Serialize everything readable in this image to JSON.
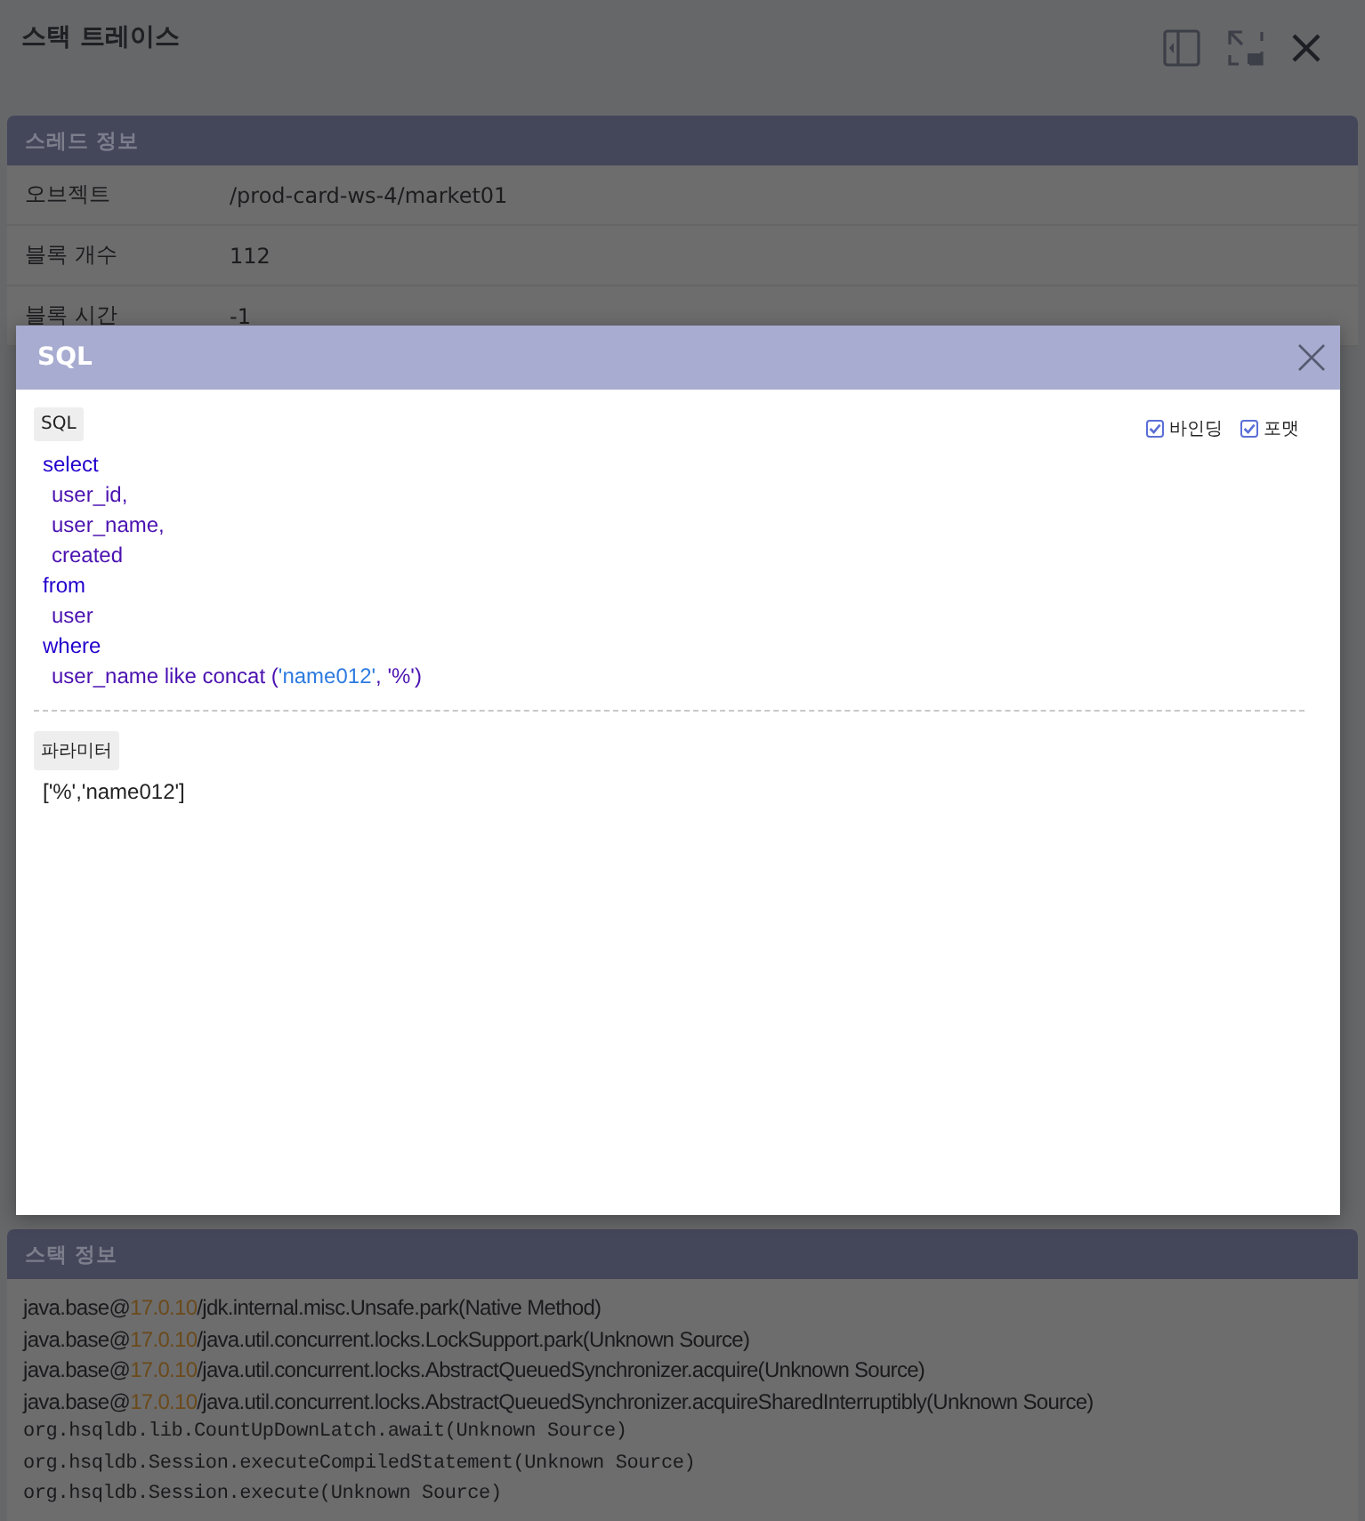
{
  "window": {
    "title": "스택 트레이스"
  },
  "thread_info": {
    "title": "스레드 정보",
    "rows": [
      {
        "label": "오브젝트",
        "value": "/prod-card-ws-4/market01"
      },
      {
        "label": "블록 개수",
        "value": "112"
      },
      {
        "label": "블록 시간",
        "value": "-1"
      }
    ]
  },
  "sql_dialog": {
    "title": "SQL",
    "sql_tag": "SQL",
    "options": [
      {
        "label": "바인딩",
        "checked": true
      },
      {
        "label": "포맷",
        "checked": true
      }
    ],
    "sql_lines": [
      {
        "indent": false,
        "segments": [
          {
            "text": "select",
            "kind": "keyword"
          }
        ]
      },
      {
        "indent": true,
        "segments": [
          {
            "text": "user_id,",
            "kind": "ident"
          }
        ]
      },
      {
        "indent": true,
        "segments": [
          {
            "text": "user_name,",
            "kind": "ident"
          }
        ]
      },
      {
        "indent": true,
        "segments": [
          {
            "text": "created",
            "kind": "ident"
          }
        ]
      },
      {
        "indent": false,
        "segments": [
          {
            "text": "from",
            "kind": "keyword"
          }
        ]
      },
      {
        "indent": true,
        "segments": [
          {
            "text": "user",
            "kind": "ident"
          }
        ]
      },
      {
        "indent": false,
        "segments": [
          {
            "text": "where",
            "kind": "keyword"
          }
        ]
      },
      {
        "indent": true,
        "segments": [
          {
            "text": "user_name like concat (",
            "kind": "ident"
          },
          {
            "text": "'name012'",
            "kind": "string"
          },
          {
            "text": ", '%')",
            "kind": "ident"
          }
        ]
      }
    ],
    "param_tag": "파라미터",
    "params": "['%','name012']"
  },
  "stack_info": {
    "title": "스택 정보",
    "lines": [
      {
        "kind": "java",
        "segments": [
          {
            "text": "java.base@",
            "kind": "plain"
          },
          {
            "text": "17.0.10",
            "kind": "version"
          },
          {
            "text": "/jdk.internal.misc.Unsafe.park(Native Method)",
            "kind": "plain"
          }
        ]
      },
      {
        "kind": "java",
        "segments": [
          {
            "text": "java.base@",
            "kind": "plain"
          },
          {
            "text": "17.0.10",
            "kind": "version"
          },
          {
            "text": "/java.util.concurrent.locks.LockSupport.park(Unknown Source)",
            "kind": "plain"
          }
        ]
      },
      {
        "kind": "java",
        "segments": [
          {
            "text": "java.base@",
            "kind": "plain"
          },
          {
            "text": "17.0.10",
            "kind": "version"
          },
          {
            "text": "/java.util.concurrent.locks.AbstractQueuedSynchronizer.acquire(Unknown Source)",
            "kind": "plain"
          }
        ]
      },
      {
        "kind": "java",
        "segments": [
          {
            "text": "java.base@",
            "kind": "plain"
          },
          {
            "text": "17.0.10",
            "kind": "version"
          },
          {
            "text": "/java.util.concurrent.locks.AbstractQueuedSynchronizer.acquireSharedInterruptibly(Unknown Source)",
            "kind": "plain"
          }
        ]
      },
      {
        "kind": "mono",
        "segments": [
          {
            "text": "org.hsqldb.lib.CountUpDownLatch.await(Unknown Source)",
            "kind": "plain"
          }
        ]
      },
      {
        "kind": "mono",
        "segments": [
          {
            "text": "org.hsqldb.Session.executeCompiledStatement(Unknown Source)",
            "kind": "plain"
          }
        ]
      },
      {
        "kind": "mono",
        "segments": [
          {
            "text": "org.hsqldb.Session.execute(Unknown Source)",
            "kind": "plain"
          }
        ]
      }
    ]
  }
}
